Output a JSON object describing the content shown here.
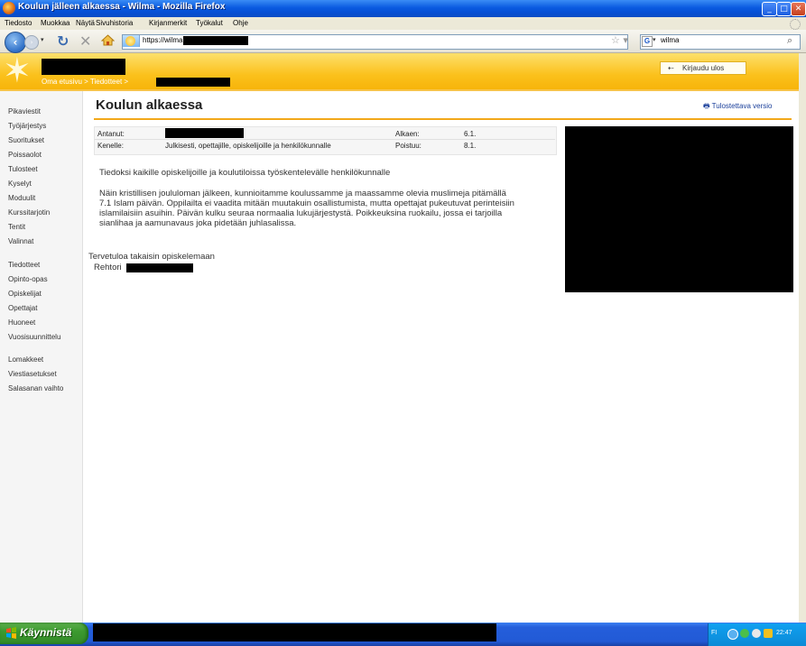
{
  "window": {
    "title": "Koulun jälleen alkaessa - Wilma - Mozilla Firefox"
  },
  "menu": [
    "Tiedosto",
    "Muokkaa",
    "Näytä",
    "Sivuhistoria",
    "Kirjanmerkit",
    "Työkalut",
    "Ohje"
  ],
  "toolbar": {
    "url": "https://wilma",
    "search_value": "wilma",
    "search_engine": "G"
  },
  "banner": {
    "breadcrumb": "Oma etusivu > Tiedotteet >",
    "logout_label": "Kirjaudu ulos"
  },
  "sidebar": {
    "group1": [
      "Pikaviestit",
      "Työjärjestys",
      "Suoritukset",
      "Poissaolot",
      "Tulosteet",
      "Kyselyt",
      "Moduulit",
      "Kurssitarjotin",
      "Tentit",
      "Valinnat"
    ],
    "group2": [
      "Tiedotteet",
      "Opinto-opas",
      "Opiskelijat",
      "Opettajat",
      "Huoneet",
      "Vuosisuunnittelu"
    ],
    "group3": [
      "Lomakkeet",
      "Viestiasetukset",
      "Salasanan vaihto"
    ]
  },
  "content": {
    "heading": "Koulun alkaessa",
    "print_link": "Tulostettava versio",
    "meta": {
      "given_by_label": "Antanut:",
      "to_label": "Kenelle:",
      "to_value": "Julkisesti, opettajille, opiskelijoille ja henkilökunnalle",
      "start_label": "Alkaen:",
      "start_value": "6.1.",
      "end_label": "Poistuu:",
      "end_value": "8.1."
    },
    "intro": "Tiedoksi kaikille opiskelijoille ja koulutiloissa työskentelevälle henkilökunnalle",
    "paragraph_lines": [
      "Näin kristillisen joululoman jälkeen, kunnioitamme koulussamme ja maassamme olevia muslimeja pitämällä",
      "7.1 Islam päivän. Oppilailta ei vaadita mitään muutakuin osallistumista, mutta opettajat pukeutuvat perinteisiin",
      "islamilaisiin asuihin. Päivän kulku seuraa normaalia lukujärjestystä. Poikkeuksina ruokailu, jossa ei tarjoilla",
      "sianlihaa ja aamunavaus joka pidetään juhlasalissa."
    ],
    "closing": "Tervetuloa takaisin opiskelemaan",
    "signature_prefix": "Rehtori"
  },
  "taskbar": {
    "start_label": "Käynnistä",
    "language": "FI",
    "clock": "22:47"
  }
}
